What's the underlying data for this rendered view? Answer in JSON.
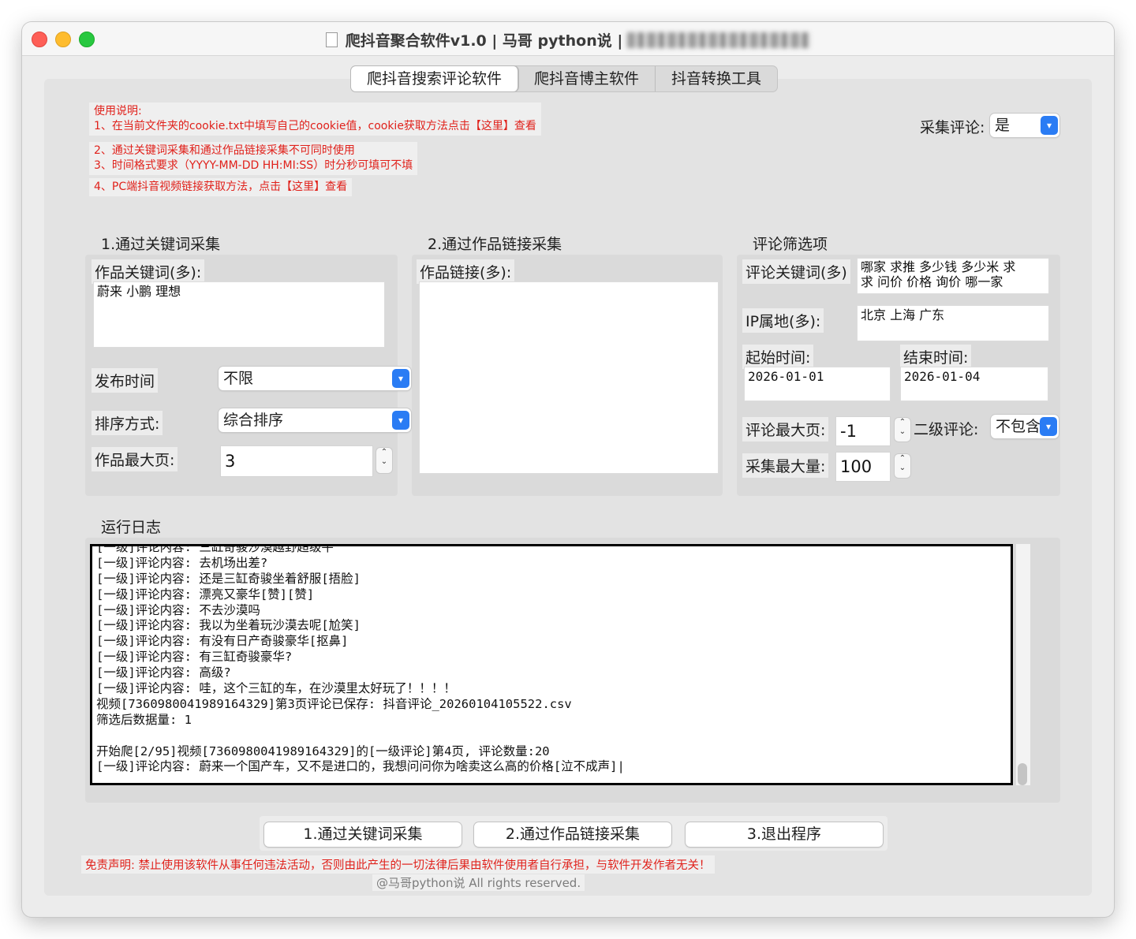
{
  "window": {
    "title_main": "爬抖音聚合软件v1.0 | 马哥 python说 |"
  },
  "tabs": [
    "爬抖音搜索评论软件",
    "爬抖音博主软件",
    "抖音转换工具"
  ],
  "instructions": {
    "line0": "使用说明:",
    "line1": "1、在当前文件夹的cookie.txt中填写自己的cookie值，cookie获取方法点击【这里】查看",
    "line2": "2、通过关键词采集和通过作品链接采集不可同时使用",
    "line3": "3、时间格式要求（YYYY-MM-DD HH:MI:SS）时分秒可填可不填",
    "line4": "4、PC端抖音视频链接获取方法，点击【这里】查看"
  },
  "collect_comments": {
    "label": "采集评论:",
    "value": "是"
  },
  "section1": {
    "title": "1.通过关键词采集",
    "keyword_label": "作品关键词(多):",
    "keyword_value": "蔚来 小鹏 理想",
    "publish_time_label": "发布时间",
    "publish_time_value": "不限",
    "sort_label": "排序方式:",
    "sort_value": "综合排序",
    "max_page_label": "作品最大页:",
    "max_page_value": "3"
  },
  "section2": {
    "title": "2.通过作品链接采集",
    "link_label": "作品链接(多):",
    "link_value": ""
  },
  "section3": {
    "title": "评论筛选项",
    "kw_label": "评论关键词(多)",
    "kw_line1": "哪家 求推 多少钱 多少米 求",
    "kw_line2": "求 问价 价格 询价 哪一家",
    "ip_label": "IP属地(多):",
    "ip_value": "北京 上海 广东",
    "start_label": "起始时间:",
    "start_value": "2026-01-01",
    "end_label": "结束时间:",
    "end_value": "2026-01-04",
    "max_comment_page_label": "评论最大页:",
    "max_comment_page_value": "-1",
    "second_level_label": "二级评论:",
    "second_level_value": "不包含",
    "max_count_label": "采集最大量:",
    "max_count_value": "100"
  },
  "log": {
    "title": "运行日志",
    "lines": [
      "[一级]评论内容: 三缸奇骏沙漠越野超级牛",
      "[一级]评论内容: 去机场出差?",
      "[一级]评论内容: 还是三缸奇骏坐着舒服[捂脸]",
      "[一级]评论内容: 漂亮又豪华[赞][赞]",
      "[一级]评论内容: 不去沙漠吗",
      "[一级]评论内容: 我以为坐着玩沙漠去呢[尬笑]",
      "[一级]评论内容: 有没有日产奇骏豪华[抠鼻]",
      "[一级]评论内容: 有三缸奇骏豪华?",
      "[一级]评论内容: 高级?",
      "[一级]评论内容: 哇，这个三缸的车，在沙漠里太好玩了！！！！",
      "视频[7360980041989164329]第3页评论已保存: 抖音评论_20260104105522.csv",
      "筛选后数据量: 1",
      "",
      "开始爬[2/95]视频[7360980041989164329]的[一级评论]第4页, 评论数量:20",
      "[一级]评论内容: 蔚来一个国产车，又不是进口的，我想问问你为啥卖这么高的价格[泣不成声]|"
    ]
  },
  "buttons": {
    "keyword_collect": "1.通过关键词采集",
    "link_collect": "2.通过作品链接采集",
    "exit": "3.退出程序"
  },
  "disclaimer": "免责声明: 禁止使用该软件从事任何违法活动，否则由此产生的一切法律后果由软件使用者自行承担，与软件开发作者无关！",
  "copyright": "@马哥python说 All rights reserved."
}
